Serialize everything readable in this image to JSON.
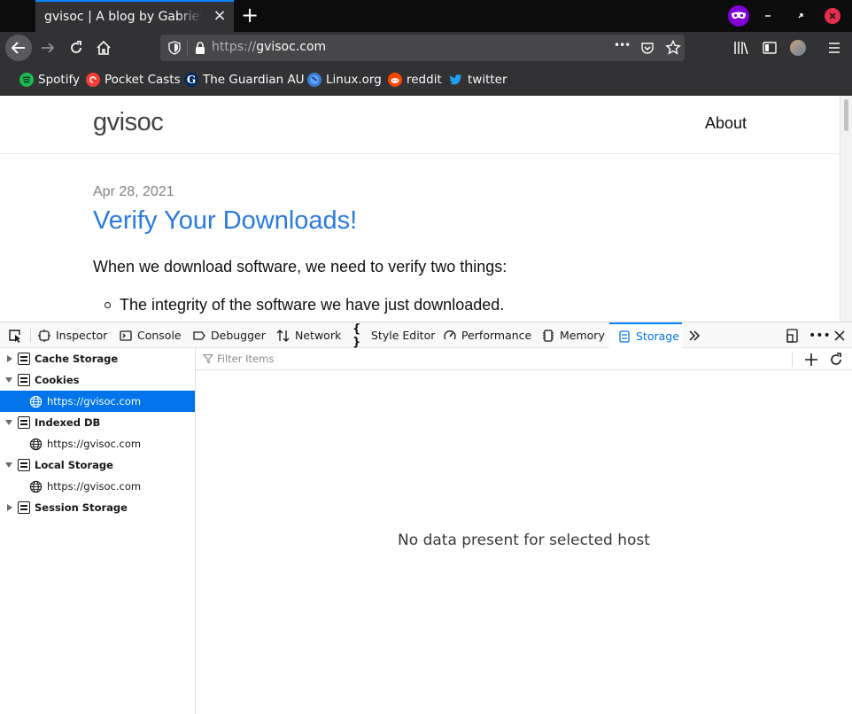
{
  "tab": {
    "title": "gvisoc | A blog by Gabriel Visoc",
    "close": "×"
  },
  "newtab": "+",
  "urlbar": {
    "scheme": "https://",
    "host": "gvisoc.com",
    "more": "•••"
  },
  "bookmarks": [
    {
      "label": "Spotify",
      "color": "#1db954"
    },
    {
      "label": "Pocket Casts",
      "color": "#f43e37"
    },
    {
      "label": "The Guardian AU",
      "color": "#052962"
    },
    {
      "label": "Linux.org",
      "color": "#3b7dd8"
    },
    {
      "label": "reddit",
      "color": "#ff4500"
    },
    {
      "label": "twitter",
      "color": "#1da1f2"
    }
  ],
  "page": {
    "site_title": "gvisoc",
    "nav_about": "About",
    "post_date": "Apr 28, 2021",
    "post_title": "Verify Your Downloads!",
    "post_intro": "When we download software, we need to verify two things:",
    "post_item_1": "The integrity of the software we have just downloaded."
  },
  "devtools": {
    "tabs": [
      {
        "label": "Inspector",
        "icon": "inspector-icon"
      },
      {
        "label": "Console",
        "icon": "console-icon"
      },
      {
        "label": "Debugger",
        "icon": "debugger-icon"
      },
      {
        "label": "Network",
        "icon": "network-icon"
      },
      {
        "label": "Style Editor",
        "icon": "style-editor-icon"
      },
      {
        "label": "Performance",
        "icon": "performance-icon"
      },
      {
        "label": "Memory",
        "icon": "memory-icon"
      },
      {
        "label": "Storage",
        "icon": "storage-icon",
        "active": true
      }
    ],
    "accent": "#0a84ff"
  },
  "storage": {
    "tree": [
      {
        "label": "Cache Storage",
        "expanded": false
      },
      {
        "label": "Cookies",
        "expanded": true,
        "host": "https://gvisoc.com",
        "host_selected": true
      },
      {
        "label": "Indexed DB",
        "expanded": true,
        "host": "https://gvisoc.com"
      },
      {
        "label": "Local Storage",
        "expanded": true,
        "host": "https://gvisoc.com"
      },
      {
        "label": "Session Storage",
        "expanded": false
      }
    ],
    "filter_placeholder": "Filter Items",
    "empty_message": "No data present for selected host"
  }
}
